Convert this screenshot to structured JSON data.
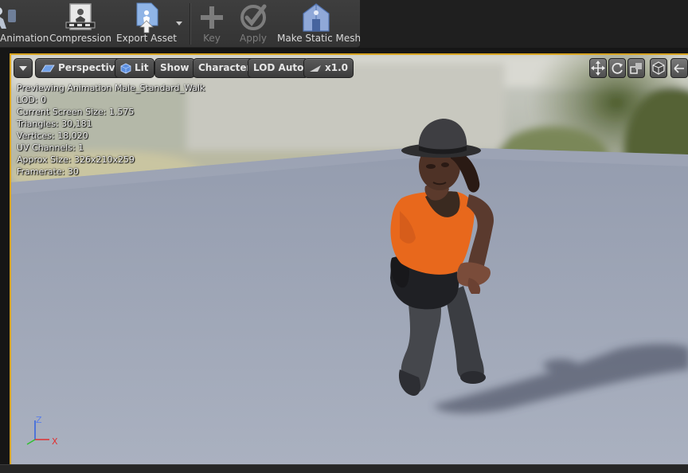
{
  "toolbar": {
    "items": [
      {
        "label": "Animation",
        "icon": "animation-icon",
        "enabled": true
      },
      {
        "label": "Compression",
        "icon": "compression-icon",
        "enabled": true
      },
      {
        "label": "Export Asset",
        "icon": "export-asset-icon",
        "enabled": true
      },
      {
        "label": "Key",
        "icon": "key-plus-icon",
        "enabled": false
      },
      {
        "label": "Apply",
        "icon": "apply-check-icon",
        "enabled": false
      },
      {
        "label": "Make Static Mesh",
        "icon": "make-static-mesh-icon",
        "enabled": true
      }
    ]
  },
  "viewport_toolbar": {
    "perspective_label": "Perspective",
    "lit_label": "Lit",
    "show_label": "Show",
    "character_label": "Character",
    "lod_label": "LOD Auto",
    "speed_label": "x1.0"
  },
  "stats": {
    "previewing": "Previewing Animation Male_Standard_Walk",
    "lod": "LOD: 0",
    "screen_size": "Current Screen Size: 1.575",
    "triangles": "Triangles: 30,181",
    "vertices": "Vertices: 18,020",
    "uv_channels": "UV Channels: 1",
    "approx_size": "Approx Size: 326x210x259",
    "framerate": "Framerate: 30"
  },
  "axis": {
    "z": "Z",
    "x": "X"
  },
  "colors": {
    "viewport_border": "#d8a420",
    "axis_x": "#e03030",
    "axis_y": "#30c030",
    "axis_z": "#3060e0",
    "shirt": "#e8681c"
  }
}
